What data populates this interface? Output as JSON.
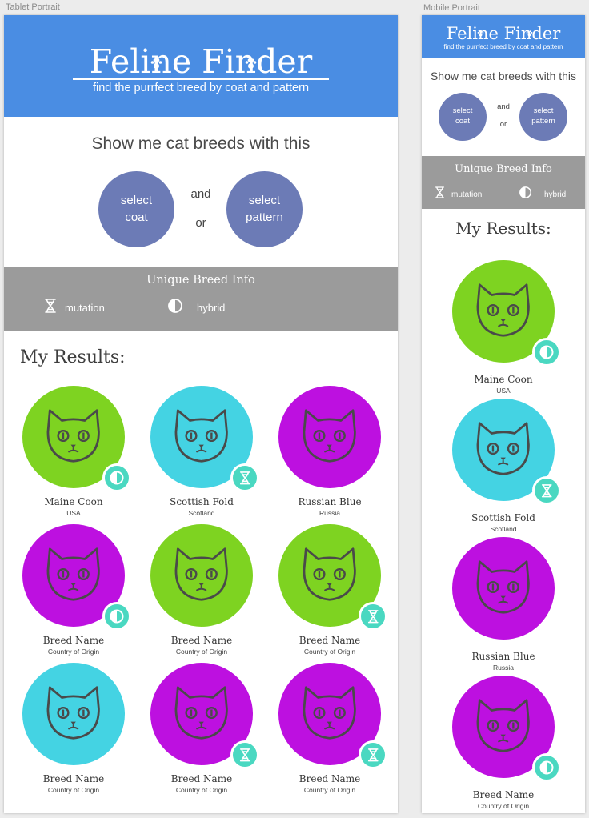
{
  "artboards": {
    "tablet_label": "Tablet Portrait",
    "mobile_label": "Mobile Portrait"
  },
  "app": {
    "logo_text": "Feline Finder",
    "tagline": "find the purrfect breed by coat and pattern"
  },
  "search": {
    "prompt": "Show me cat breeds with this",
    "coat_button": "select coat",
    "and_label": "and",
    "or_label": "or",
    "pattern_button": "select pattern"
  },
  "info": {
    "title": "Unique Breed Info",
    "mutation_label": "mutation",
    "hybrid_label": "hybrid"
  },
  "results_title": "My Results:",
  "colors": {
    "header": "#4a8de3",
    "button": "#6c7bb6",
    "info_band": "#9b9b9b",
    "green": "#7ed321",
    "cyan": "#44d3e3",
    "purple": "#bd10e0",
    "badge": "#4ad8c1",
    "cat_line": "#4a4a4a"
  },
  "tablet_results": [
    {
      "name": "Maine Coon",
      "origin": "USA",
      "color": "green",
      "badge": "hybrid-icon"
    },
    {
      "name": "Scottish Fold",
      "origin": "Scotland",
      "color": "cyan",
      "badge": "mutation-icon"
    },
    {
      "name": "Russian Blue",
      "origin": "Russia",
      "color": "purple",
      "badge": ""
    },
    {
      "name": "Breed Name",
      "origin": "Country of Origin",
      "color": "purple",
      "badge": "hybrid-icon"
    },
    {
      "name": "Breed Name",
      "origin": "Country of Origin",
      "color": "green",
      "badge": ""
    },
    {
      "name": "Breed Name",
      "origin": "Country of Origin",
      "color": "green",
      "badge": "mutation-icon"
    },
    {
      "name": "Breed Name",
      "origin": "Country of Origin",
      "color": "cyan",
      "badge": ""
    },
    {
      "name": "Breed Name",
      "origin": "Country of Origin",
      "color": "purple",
      "badge": "mutation-icon"
    },
    {
      "name": "Breed Name",
      "origin": "Country of Origin",
      "color": "purple",
      "badge": "mutation-icon"
    }
  ],
  "mobile_results": [
    {
      "name": "Maine Coon",
      "origin": "USA",
      "color": "green",
      "badge": "hybrid-icon"
    },
    {
      "name": "Scottish Fold",
      "origin": "Scotland",
      "color": "cyan",
      "badge": "mutation-icon"
    },
    {
      "name": "Russian Blue",
      "origin": "Russia",
      "color": "purple",
      "badge": ""
    },
    {
      "name": "Breed Name",
      "origin": "Country of Origin",
      "color": "purple",
      "badge": "hybrid-icon"
    }
  ]
}
